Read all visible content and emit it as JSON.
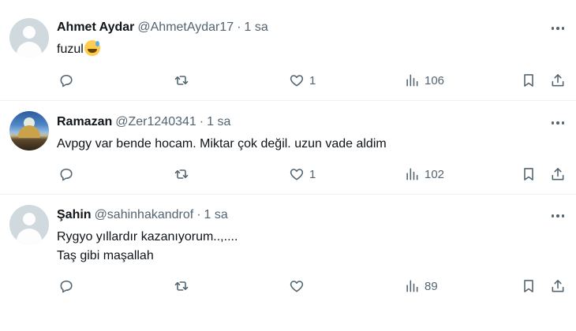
{
  "tweets": [
    {
      "name": "Ahmet Aydar",
      "handle": "@AhmetAydar17",
      "time": "1 sa",
      "lines": [
        "fuzul"
      ],
      "has_emoji": true,
      "avatar": "default-avatar",
      "stats": {
        "replies": "",
        "retweets": "",
        "likes": "1",
        "views": "106"
      }
    },
    {
      "name": "Ramazan",
      "handle": "@Zer1240341",
      "time": "1 sa",
      "lines": [
        "Avpgy var bende hocam. Miktar çok değil. uzun vade aldim"
      ],
      "has_emoji": false,
      "avatar": "photo-avatar",
      "stats": {
        "replies": "",
        "retweets": "",
        "likes": "1",
        "views": "102"
      }
    },
    {
      "name": "Şahin",
      "handle": "@sahinhakandrof",
      "time": "1 sa",
      "lines": [
        "Rygyo yıllardır kazanıyorum..,....",
        "Taş gibi maşallah"
      ],
      "has_emoji": false,
      "avatar": "default-avatar",
      "stats": {
        "replies": "",
        "retweets": "",
        "likes": "",
        "views": "89"
      }
    }
  ],
  "separator": "·",
  "icons": [
    "reply-icon",
    "retweet-icon",
    "like-icon",
    "views-icon",
    "bookmark-icon",
    "share-icon",
    "more-icon"
  ],
  "colors": {
    "text": "#0f1419",
    "secondary": "#536471",
    "divider": "#eff3f4"
  }
}
